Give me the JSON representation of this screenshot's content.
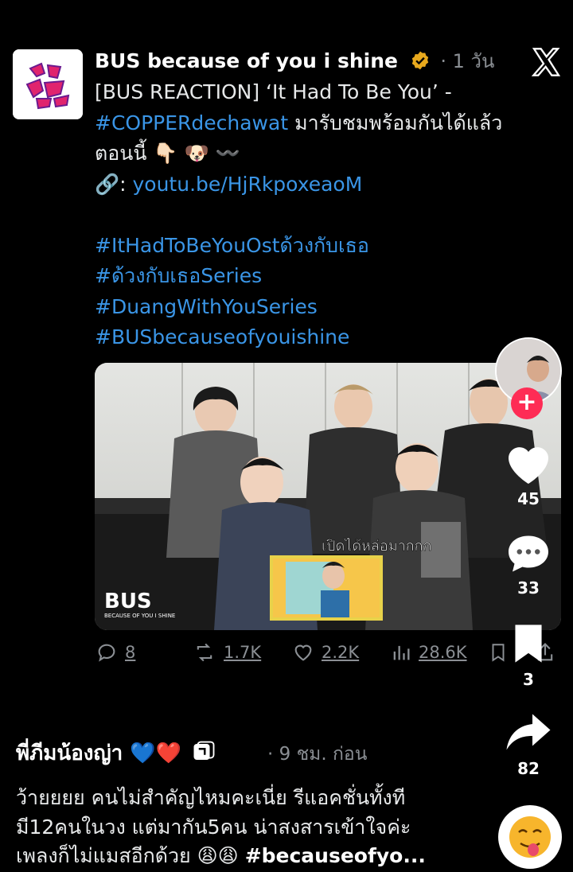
{
  "tweet": {
    "author": "BUS because of you i shine",
    "time": "· 1 วัน",
    "lines": {
      "l1": "[BUS REACTION] ‘It Had To Be You’ -",
      "l2_tag": "#COPPERdechawat",
      "l2_rest": " มารับชมพร้อมกันได้แล้ว",
      "l3": "ตอนนี้ 👇🏻 🐶 〰️",
      "l4_prefix": "🔗: ",
      "l4_link": "youtu.be/HjRkpoxeaoM",
      "h1": "#ItHadToBeYouOstด้วงกับเธอ",
      "h2": "#ด้วงกับเธอSeries",
      "h3": "#DuangWithYouSeries",
      "h4": "#BUSbecauseofyouishine"
    },
    "media": {
      "caption": "เปิดได้หล่อมากกก",
      "watermark": "BUS",
      "watermark_sub": "BECAUSE OF YOU I SHINE"
    },
    "actions": {
      "replies": "8",
      "retweets": "1.7K",
      "likes": "2.2K",
      "views": "28.6K"
    }
  },
  "rail": {
    "likes": "45",
    "comments": "33",
    "saves": "3",
    "shares": "82"
  },
  "comment": {
    "author": "พี่ภีมน้องญ่า",
    "hearts": "💙❤️",
    "time": "· 9 ชม. ก่อน",
    "line1": "ว้ายยยย คนไม่สำคัญไหมคะเนี่ย รีแอคชั่นทั้งที",
    "line2": "มี12คนในวง แต่มากัน5คน น่าสงสารเข้าใจค่ะ",
    "line3_text": "เพลงก็ไม่แมสอีกด้วย 😩😩 ",
    "line3_tag": "#becauseofyo..."
  },
  "colors": {
    "link": "#3a95e6",
    "muted": "#8b8f94",
    "tiktok_red": "#fe2c55",
    "avatar_pink": "#e0246e"
  }
}
